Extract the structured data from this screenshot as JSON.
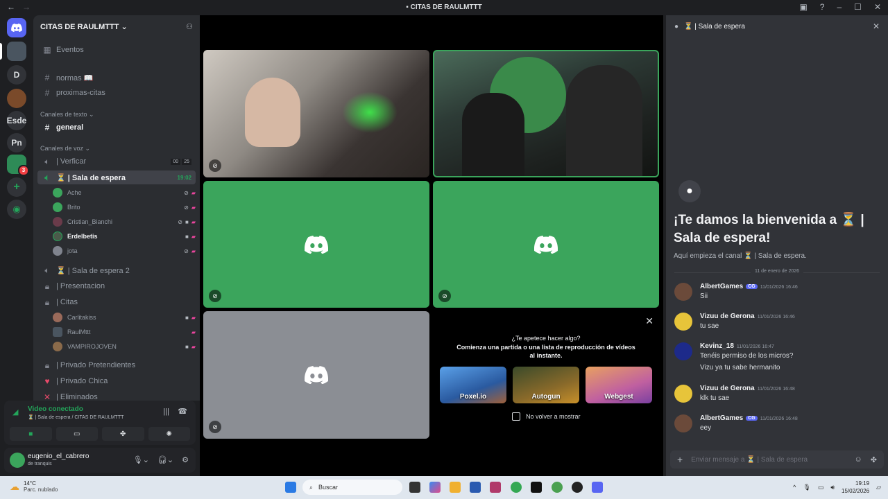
{
  "window": {
    "title": "CITAS DE RAULMTTT",
    "back": "←",
    "forward": "→"
  },
  "servers": {
    "items": [
      {
        "label": "D"
      },
      {
        "label": "Esde"
      },
      {
        "label": "Pn"
      }
    ],
    "badge": "3"
  },
  "server": {
    "name": "CITAS DE RAULMTTT",
    "events": "Eventos",
    "channels": [
      {
        "label": "normas 📖"
      },
      {
        "label": "proximas-citas"
      }
    ],
    "text_category": "Canales de texto",
    "general": "general",
    "voice_category": "Canales de voz",
    "verify": {
      "label": "| Verficar",
      "count": "00",
      "limit": "25"
    },
    "waiting": {
      "label": "⏳ | Sala de espera",
      "timer": "19:02"
    },
    "waiting_users": [
      {
        "name": "Ache"
      },
      {
        "name": "Brito"
      },
      {
        "name": "Cristian_Bianchi"
      },
      {
        "name": "Erdelbetis"
      },
      {
        "name": "jota"
      }
    ],
    "waiting2": "⏳ | Sala de espera 2",
    "presentacion": "| Presentacion",
    "citas": "| Citas",
    "citas_users": [
      {
        "name": "Carlitakiss"
      },
      {
        "name": "RaulMttt"
      },
      {
        "name": "VAMPIROJOVEN"
      }
    ],
    "privado_pret": "| Privado Pretendientes",
    "privado_chica": "| Privado Chica",
    "eliminados": "| Eliminados"
  },
  "voice_panel": {
    "title": "Video conectado",
    "subtitle": "⏳ | Sala de espera / CITAS DE RAULMTTT"
  },
  "user_panel": {
    "name": "eugenio_el_cabrero",
    "status": "de tranquis"
  },
  "activity": {
    "question": "¿Te apetece hacer algo?",
    "description": "Comienza una partida o una lista de reproducción de vídeos al instante.",
    "games": [
      {
        "name": "Poxel.io",
        "color": "#3a7bd5"
      },
      {
        "name": "Autogun",
        "color": "#7a5a1c"
      },
      {
        "name": "Webgest",
        "color": "#b84aa0"
      }
    ],
    "dont_show": "No volver a mostrar"
  },
  "chat": {
    "header": "⏳ | Sala de espera",
    "welcome_title": "¡Te damos la bienvenida a ⏳ | Sala de espera!",
    "welcome_sub": "Aquí empieza el canal ⏳ | Sala de espera.",
    "date_divider": "11 de enero de 2026",
    "messages": [
      {
        "author": "AlbertGames",
        "tag": "CG",
        "time": "11/01/2026 16:46",
        "text": "Sii",
        "avatar_color": "#6b4a3a"
      },
      {
        "author": "Vizuu de Gerona",
        "time": "11/01/2026 16:46",
        "text": "tu sae",
        "avatar_color": "#e7c43a"
      },
      {
        "author": "Kevinz_18",
        "time": "11/01/2026 16:47",
        "text": "Tenéis permiso de los micros?",
        "text2": "Vizu ya tu sabe hermanito",
        "avatar_color": "#1d2a8a"
      },
      {
        "author": "Vizuu de Gerona",
        "time": "11/01/2026 16:48",
        "text": "klk tu sae",
        "avatar_color": "#e7c43a"
      },
      {
        "author": "AlbertGames",
        "tag": "CG",
        "time": "11/01/2026 16:48",
        "text": "eey",
        "avatar_color": "#6b4a3a"
      }
    ],
    "placeholder": "Enviar mensaje a ⏳ | Sala de espera"
  },
  "taskbar": {
    "temp": "14°C",
    "weather": "Parc. nublado",
    "search": "Buscar",
    "time": "19:19",
    "date": "15/02/2026"
  },
  "colors": {
    "green": "#3ba55c",
    "blurple": "#5865f2",
    "live": "#eb459e"
  }
}
